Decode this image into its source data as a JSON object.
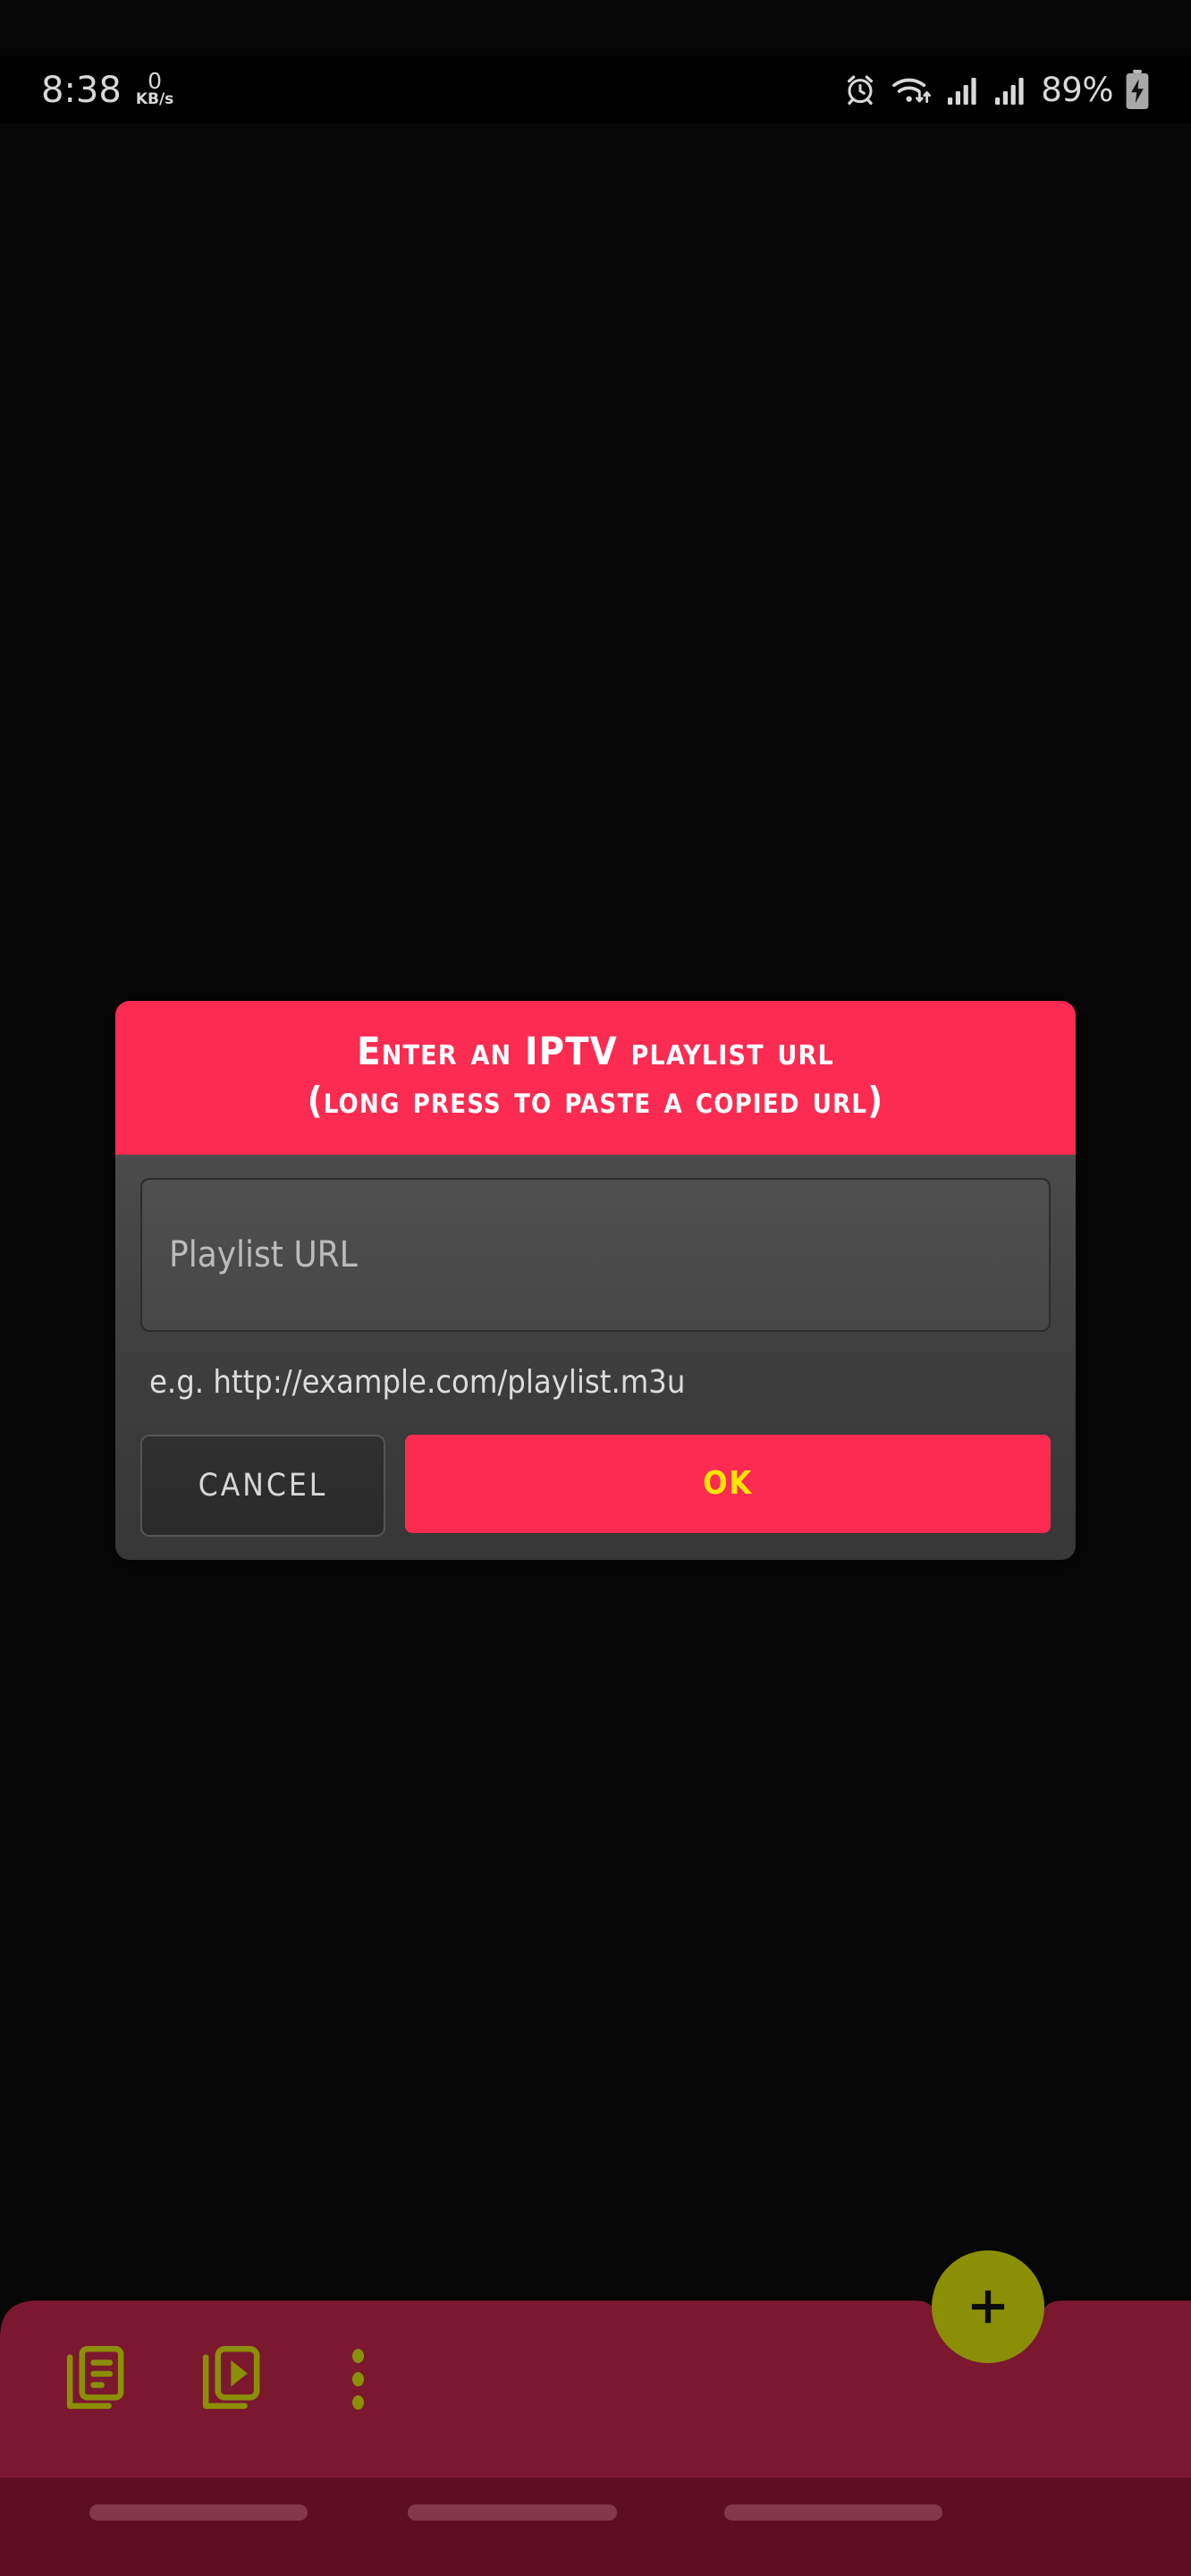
{
  "status_bar": {
    "time": "8:38",
    "net_speed_value": "0",
    "net_speed_unit": "KB/s",
    "battery_percent": "89%",
    "icons": [
      "alarm-icon",
      "wifi-icon",
      "signal-icon-sim1",
      "signal-icon-sim2",
      "battery-charging-icon"
    ]
  },
  "dialog": {
    "title_line1": "Enter an IPTV playlist url",
    "title_line2": "(long press to paste a copied url)",
    "input": {
      "placeholder": "Playlist URL",
      "value": ""
    },
    "hint": "e.g. http://example.com/playlist.m3u",
    "cancel_label": "CANCEL",
    "ok_label": "OK",
    "header_color": "#fb2b52",
    "ok_text_color": "#ffe500",
    "body_color": "#404040"
  },
  "bottom_bar": {
    "background_color": "#7b1830",
    "accent_color": "#8b8f06",
    "items": [
      {
        "name": "playlists-tab",
        "icon": "playlist-document-icon"
      },
      {
        "name": "video-playlists-tab",
        "icon": "video-playlist-icon"
      },
      {
        "name": "overflow-menu",
        "icon": "more-vertical-icon"
      }
    ],
    "fab": {
      "icon": "plus-icon",
      "label": "+"
    }
  },
  "gesture_bar": {
    "pills": [
      "recents-pill",
      "home-pill",
      "back-pill"
    ]
  }
}
